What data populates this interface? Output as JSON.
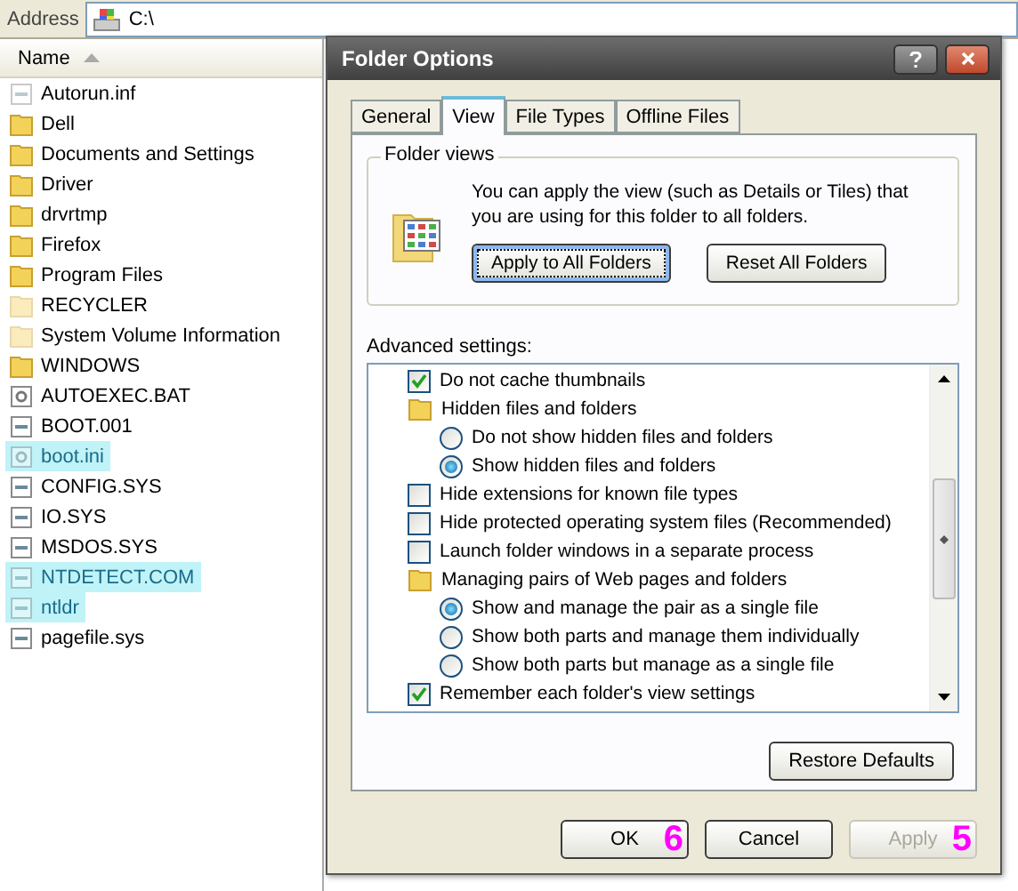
{
  "address_bar": {
    "label": "Address",
    "value": "C:\\"
  },
  "file_list": {
    "column": "Name",
    "files": [
      {
        "name": "Autorun.inf",
        "kind": "file",
        "hidden": true,
        "highlighted": false
      },
      {
        "name": "Dell",
        "kind": "folder",
        "hidden": false,
        "highlighted": false
      },
      {
        "name": "Documents and Settings",
        "kind": "folder",
        "hidden": false,
        "highlighted": false
      },
      {
        "name": "Driver",
        "kind": "folder",
        "hidden": false,
        "highlighted": false
      },
      {
        "name": "drvrtmp",
        "kind": "folder",
        "hidden": false,
        "highlighted": false
      },
      {
        "name": "Firefox",
        "kind": "folder",
        "hidden": false,
        "highlighted": false
      },
      {
        "name": "Program Files",
        "kind": "folder",
        "hidden": false,
        "highlighted": false
      },
      {
        "name": "RECYCLER",
        "kind": "folder",
        "hidden": true,
        "highlighted": false
      },
      {
        "name": "System Volume Information",
        "kind": "folder",
        "hidden": true,
        "highlighted": false
      },
      {
        "name": "WINDOWS",
        "kind": "folder",
        "hidden": false,
        "highlighted": false
      },
      {
        "name": "AUTOEXEC.BAT",
        "kind": "settings",
        "hidden": false,
        "highlighted": false
      },
      {
        "name": "BOOT.001",
        "kind": "file",
        "hidden": false,
        "highlighted": false
      },
      {
        "name": "boot.ini",
        "kind": "settings",
        "hidden": true,
        "highlighted": true
      },
      {
        "name": "CONFIG.SYS",
        "kind": "file",
        "hidden": false,
        "highlighted": false
      },
      {
        "name": "IO.SYS",
        "kind": "file",
        "hidden": false,
        "highlighted": false
      },
      {
        "name": "MSDOS.SYS",
        "kind": "file",
        "hidden": false,
        "highlighted": false
      },
      {
        "name": "NTDETECT.COM",
        "kind": "file",
        "hidden": true,
        "highlighted": true
      },
      {
        "name": "ntldr",
        "kind": "file",
        "hidden": true,
        "highlighted": true
      },
      {
        "name": "pagefile.sys",
        "kind": "file",
        "hidden": false,
        "highlighted": false
      }
    ]
  },
  "dialog": {
    "title": "Folder Options",
    "tabs": [
      {
        "label": "General",
        "selected": false
      },
      {
        "label": "View",
        "selected": true
      },
      {
        "label": "File Types",
        "selected": false
      },
      {
        "label": "Offline Files",
        "selected": false
      }
    ],
    "folder_views": {
      "title": "Folder views",
      "text": "You can apply the view (such as Details or Tiles) that you are using for this folder to all folders.",
      "buttons": [
        {
          "label": "Apply to All Folders",
          "focused": true
        },
        {
          "label": "Reset All Folders",
          "focused": false
        }
      ]
    },
    "advanced_settings": {
      "label": "Advanced settings:",
      "items": [
        {
          "kind": "checkbox",
          "label": "Do not cache thumbnails",
          "checked": true
        },
        {
          "kind": "folder",
          "label": "Hidden files and folders",
          "children": [
            {
              "kind": "radio",
              "label": "Do not show hidden files and folders",
              "selected": false
            },
            {
              "kind": "radio",
              "label": "Show hidden files and folders",
              "selected": true
            }
          ]
        },
        {
          "kind": "checkbox",
          "label": "Hide extensions for known file types",
          "checked": false
        },
        {
          "kind": "checkbox",
          "label": "Hide protected operating system files (Recommended)",
          "checked": false
        },
        {
          "kind": "checkbox",
          "label": "Launch folder windows in a separate process",
          "checked": false
        },
        {
          "kind": "folder",
          "label": "Managing pairs of Web pages and folders",
          "children": [
            {
              "kind": "radio",
              "label": "Show and manage the pair as a single file",
              "selected": true
            },
            {
              "kind": "radio",
              "label": "Show both parts and manage them individually",
              "selected": false
            },
            {
              "kind": "radio",
              "label": "Show both parts but manage as a single file",
              "selected": false
            }
          ]
        },
        {
          "kind": "checkbox",
          "label": "Remember each folder's view settings",
          "checked": true
        }
      ],
      "restore_button": "Restore Defaults"
    },
    "buttons": [
      {
        "label": "OK",
        "disabled": false,
        "marker": "6"
      },
      {
        "label": "Cancel",
        "disabled": false
      },
      {
        "label": "Apply",
        "disabled": true,
        "marker": "5"
      }
    ]
  }
}
